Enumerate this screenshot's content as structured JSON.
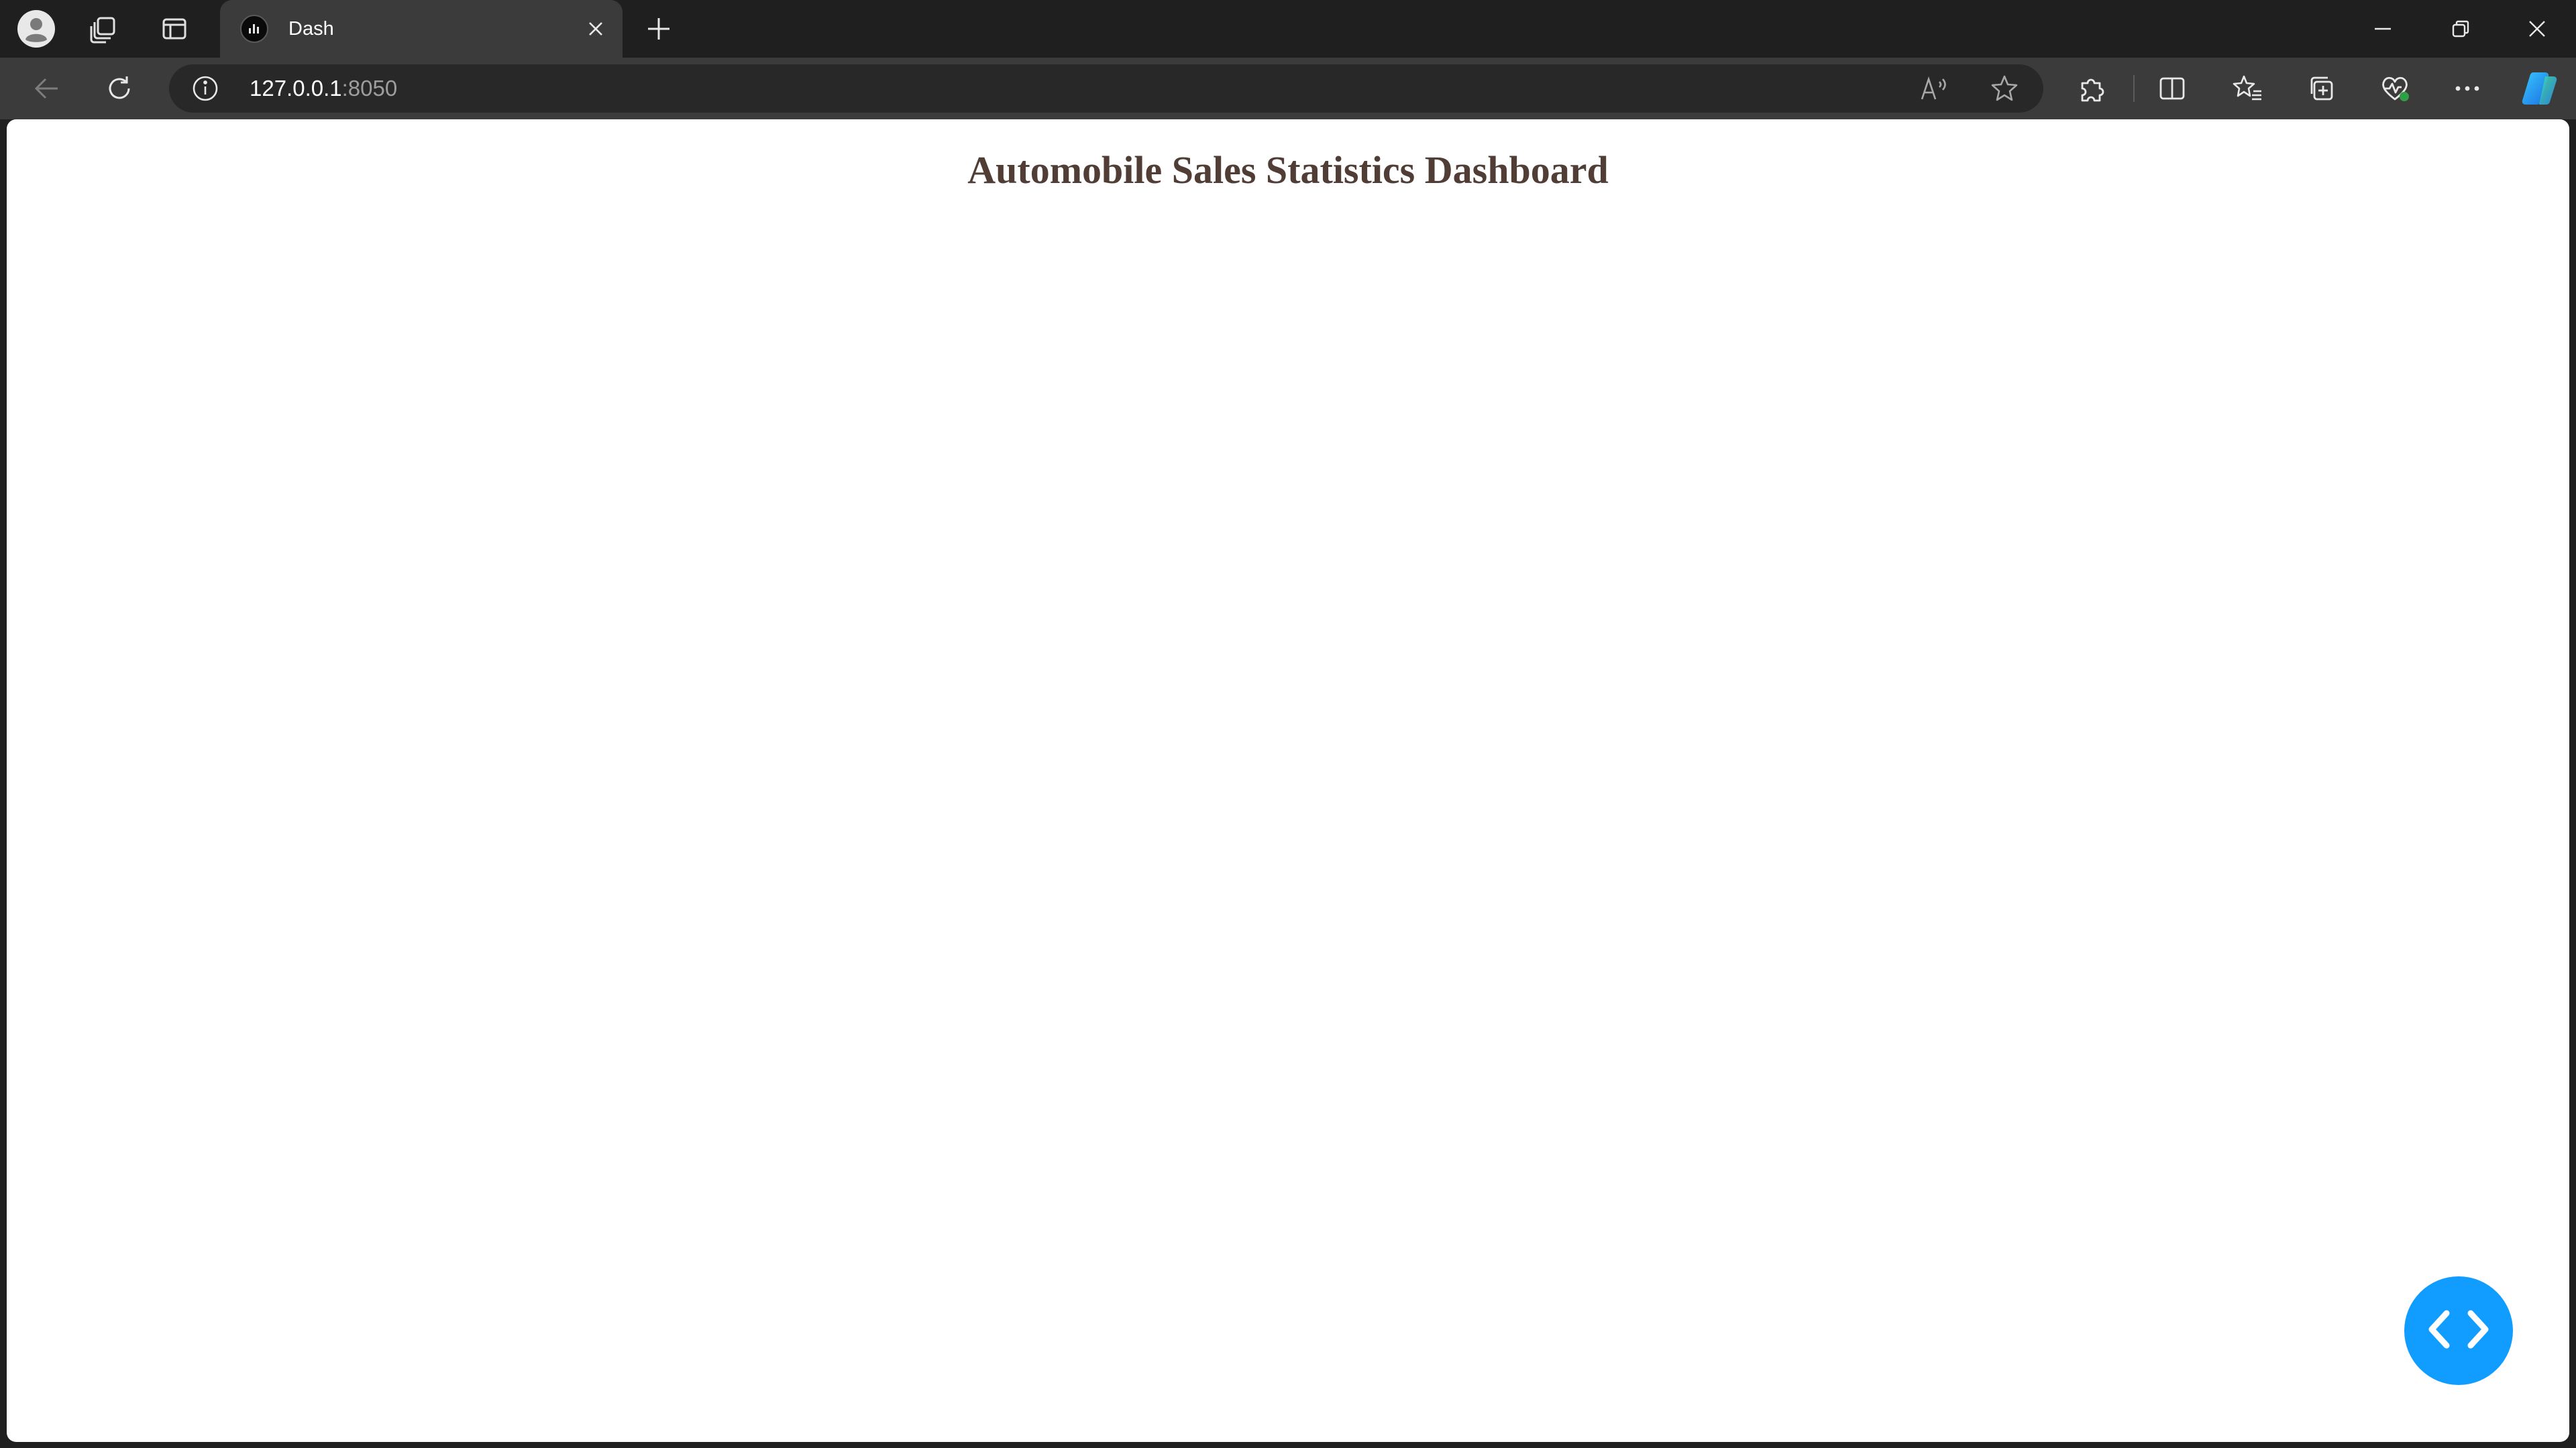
{
  "browser": {
    "tab": {
      "title": "Dash",
      "favicon": "dash-favicon-icon"
    },
    "address_bar": {
      "url_host": "127.0.0.1",
      "url_port": ":8050"
    },
    "icons": {
      "profile": "profile-avatar-icon",
      "workspaces": "workspaces-icon",
      "vertical_tabs": "vertical-tabs-icon",
      "close_tab": "close-icon",
      "new_tab": "plus-icon",
      "back": "back-arrow-icon",
      "refresh": "refresh-icon",
      "site_info": "info-icon",
      "read_aloud": "read-aloud-icon",
      "favorite": "star-icon",
      "extensions": "puzzle-icon",
      "split_screen": "split-screen-icon",
      "favorites": "favorites-list-icon",
      "collections": "collections-icon",
      "browser_essentials": "heart-pulse-icon",
      "more": "more-icon",
      "copilot": "copilot-icon"
    },
    "colors": {
      "tabstrip_bg": "#1f1f1f",
      "toolbar_bg": "#3b3b3b",
      "omnibox_bg": "#282828"
    }
  },
  "page": {
    "title": "Automobile Sales Statistics Dashboard",
    "title_color": "#503d36",
    "devtools_button": {
      "icon": "code-brackets-icon",
      "color": "#119dff"
    }
  }
}
